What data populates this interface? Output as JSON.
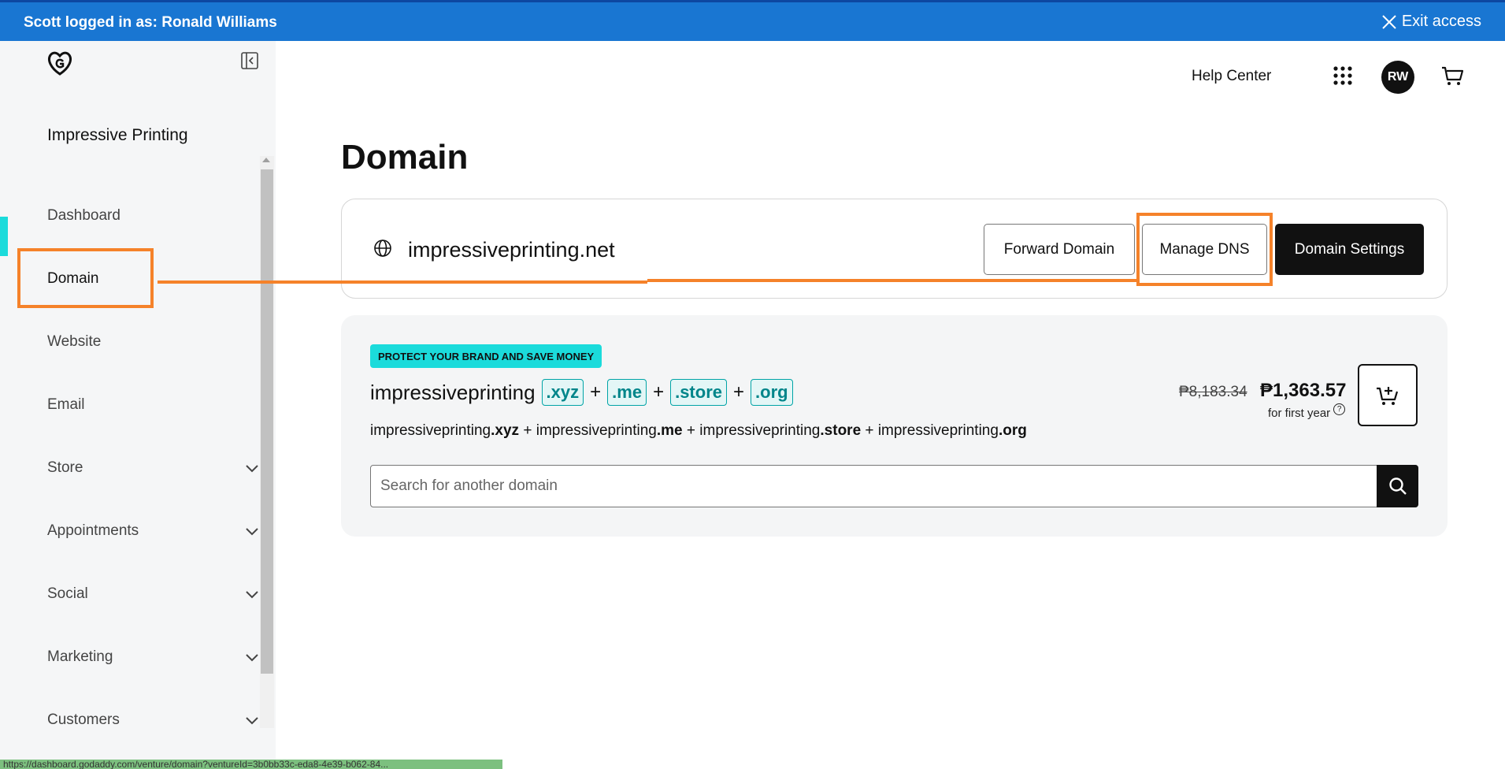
{
  "banner": {
    "text": "Scott logged in as: Ronald Williams",
    "exit_label": "Exit access"
  },
  "sidebar": {
    "business_name": "Impressive Printing",
    "items": [
      {
        "label": "Dashboard",
        "has_chevron": false,
        "active": false
      },
      {
        "label": "Domain",
        "has_chevron": false,
        "active": true
      },
      {
        "label": "Website",
        "has_chevron": false,
        "active": false
      },
      {
        "label": "Email",
        "has_chevron": false,
        "active": false
      },
      {
        "label": "Store",
        "has_chevron": true,
        "active": false
      },
      {
        "label": "Appointments",
        "has_chevron": true,
        "active": false
      },
      {
        "label": "Social",
        "has_chevron": true,
        "active": false
      },
      {
        "label": "Marketing",
        "has_chevron": true,
        "active": false
      },
      {
        "label": "Customers",
        "has_chevron": true,
        "active": false
      }
    ],
    "accent_color": "#1bdbdb"
  },
  "header": {
    "help_center": "Help Center",
    "avatar_initials": "RW"
  },
  "main": {
    "title": "Domain",
    "domain_card": {
      "domain": "impressiveprinting.net",
      "forward_label": "Forward Domain",
      "manage_dns_label": "Manage DNS",
      "settings_label": "Domain Settings"
    },
    "promo": {
      "badge": "PROTECT YOUR BRAND AND SAVE MONEY",
      "base_name": "impressiveprinting",
      "tlds": [
        ".xyz",
        ".me",
        ".store",
        ".org"
      ],
      "plus": "+",
      "full_names": [
        {
          "base": "impressiveprinting",
          "tld": ".xyz"
        },
        {
          "base": "impressiveprinting",
          "tld": ".me"
        },
        {
          "base": "impressiveprinting",
          "tld": ".store"
        },
        {
          "base": "impressiveprinting",
          "tld": ".org"
        }
      ],
      "old_price": "₱8,183.34",
      "new_price": "₱1,363.57",
      "price_note": "for first year",
      "search_placeholder": "Search for another domain",
      "search_value": ""
    }
  },
  "annotation_color": "#f5822a",
  "status_bar_url": "https://dashboard.godaddy.com/venture/domain?ventureId=3b0bb33c-eda8-4e39-b062-84..."
}
